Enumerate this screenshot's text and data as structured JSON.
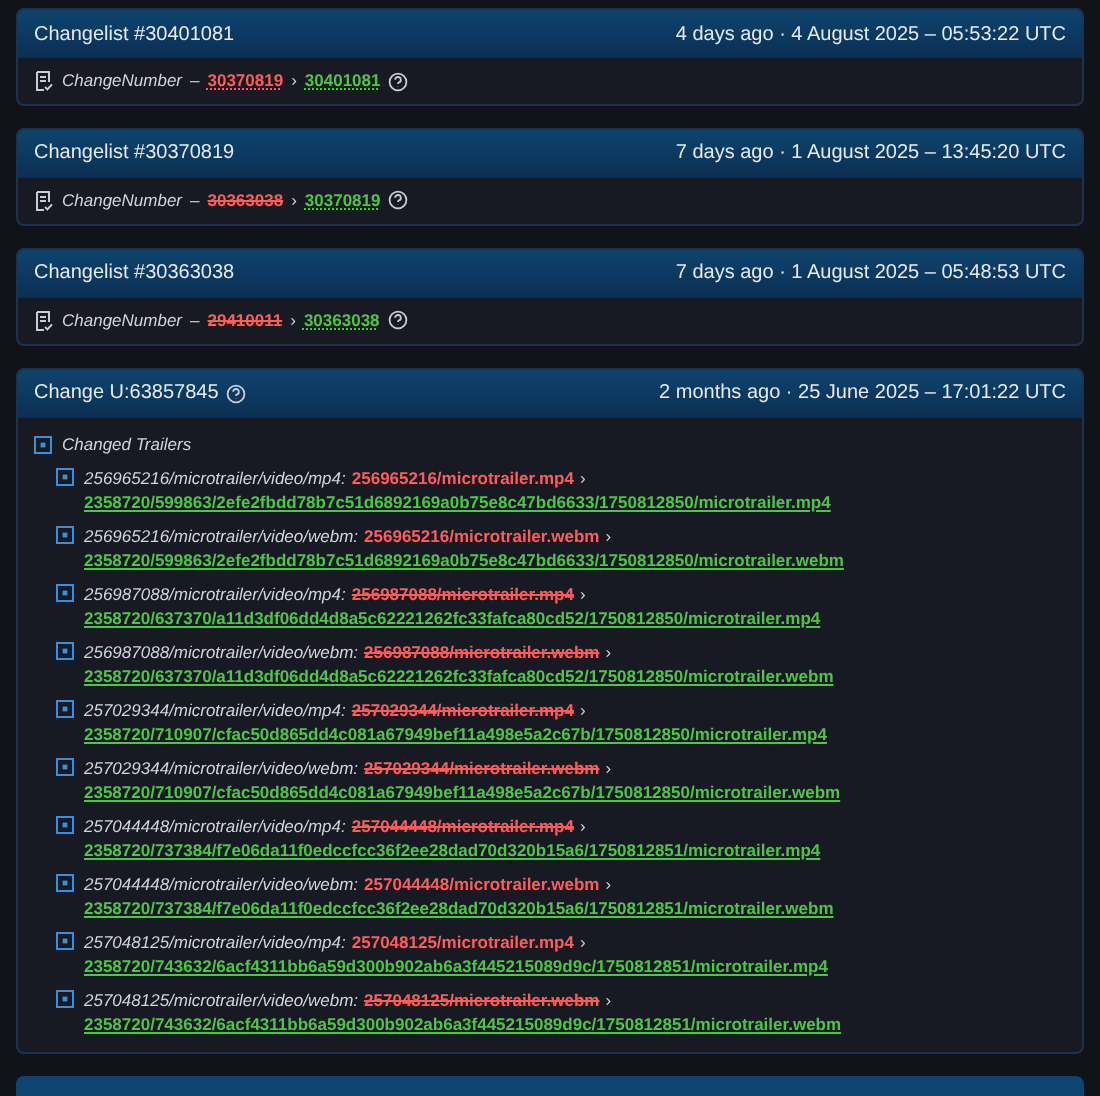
{
  "changelists": [
    {
      "title": "Changelist #30401081",
      "time": "4 days ago · 4 August 2025 – 05:53:22 UTC",
      "field": "ChangeNumber",
      "separator": "–",
      "old": "30370819",
      "old_struck": false,
      "arrow": "›",
      "new": "30401081"
    },
    {
      "title": "Changelist #30370819",
      "time": "7 days ago · 1 August 2025 – 13:45:20 UTC",
      "field": "ChangeNumber",
      "separator": "–",
      "old": "30363038",
      "old_struck": true,
      "arrow": "›",
      "new": "30370819"
    },
    {
      "title": "Changelist #30363038",
      "time": "7 days ago · 1 August 2025 – 05:48:53 UTC",
      "field": "ChangeNumber",
      "separator": "–",
      "old": "29410011",
      "old_struck": true,
      "arrow": "›",
      "new": "30363038"
    }
  ],
  "change": {
    "title": "Change U:63857845",
    "time": "2 months ago · 25 June 2025 – 17:01:22 UTC",
    "section": "Changed Trailers",
    "trailers": [
      {
        "key": "256965216/microtrailer/video/mp4:",
        "old": "256965216/microtrailer.mp4",
        "old_struck": false,
        "arrow": "›",
        "new": "2358720/599863/2efe2fbdd78b7c51d6892169a0b75e8c47bd6633/1750812850/microtrailer.mp4"
      },
      {
        "key": "256965216/microtrailer/video/webm:",
        "old": "256965216/microtrailer.webm",
        "old_struck": false,
        "arrow": "›",
        "new": "2358720/599863/2efe2fbdd78b7c51d6892169a0b75e8c47bd6633/1750812850/microtrailer.webm"
      },
      {
        "key": "256987088/microtrailer/video/mp4:",
        "old": "256987088/microtrailer.mp4",
        "old_struck": true,
        "arrow": "›",
        "new": "2358720/637370/a11d3df06dd4d8a5c62221262fc33fafca80cd52/1750812850/microtrailer.mp4"
      },
      {
        "key": "256987088/microtrailer/video/webm:",
        "old": "256987088/microtrailer.webm",
        "old_struck": true,
        "arrow": "›",
        "new": "2358720/637370/a11d3df06dd4d8a5c62221262fc33fafca80cd52/1750812850/microtrailer.webm"
      },
      {
        "key": "257029344/microtrailer/video/mp4:",
        "old": "257029344/microtrailer.mp4",
        "old_struck": true,
        "arrow": "›",
        "new": "2358720/710907/cfac50d865dd4c081a67949bef11a498e5a2c67b/1750812850/microtrailer.mp4"
      },
      {
        "key": "257029344/microtrailer/video/webm:",
        "old": "257029344/microtrailer.webm",
        "old_struck": true,
        "arrow": "›",
        "new": "2358720/710907/cfac50d865dd4c081a67949bef11a498e5a2c67b/1750812850/microtrailer.webm"
      },
      {
        "key": "257044448/microtrailer/video/mp4:",
        "old": "257044448/microtrailer.mp4",
        "old_struck": true,
        "arrow": "›",
        "new": "2358720/737384/f7e06da11f0edccfcc36f2ee28dad70d320b15a6/1750812851/microtrailer.mp4"
      },
      {
        "key": "257044448/microtrailer/video/webm:",
        "old": "257044448/microtrailer.webm",
        "old_struck": false,
        "arrow": "›",
        "new": "2358720/737384/f7e06da11f0edccfcc36f2ee28dad70d320b15a6/1750812851/microtrailer.webm"
      },
      {
        "key": "257048125/microtrailer/video/mp4:",
        "old": "257048125/microtrailer.mp4",
        "old_struck": false,
        "arrow": "›",
        "new": "2358720/743632/6acf4311bb6a59d300b902ab6a3f445215089d9c/1750812851/microtrailer.mp4"
      },
      {
        "key": "257048125/microtrailer/video/webm:",
        "old": "257048125/microtrailer.webm",
        "old_struck": true,
        "arrow": "›",
        "new": "2358720/743632/6acf4311bb6a59d300b902ab6a3f445215089d9c/1750812851/microtrailer.webm"
      }
    ]
  }
}
